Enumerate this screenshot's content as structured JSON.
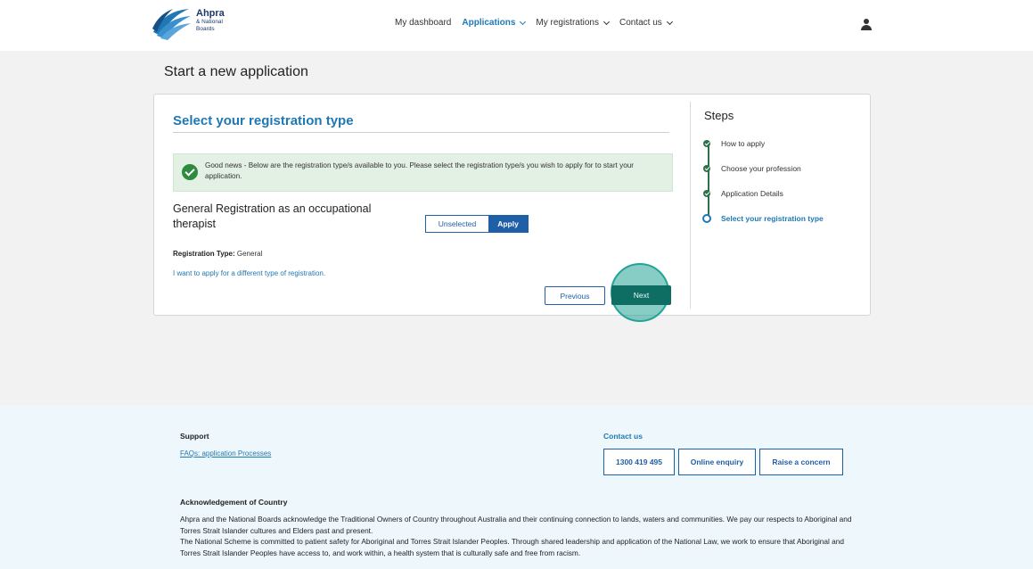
{
  "header": {
    "logo": {
      "title": "Ahpra",
      "line2": "& National",
      "line3": "Boards"
    },
    "nav": [
      {
        "label": "My dashboard",
        "dropdown": false,
        "active": false
      },
      {
        "label": "Applications",
        "dropdown": true,
        "active": true
      },
      {
        "label": "My registrations",
        "dropdown": true,
        "active": false
      },
      {
        "label": "Contact us",
        "dropdown": true,
        "active": false
      }
    ],
    "user_icon": "user-icon"
  },
  "page_title": "Start a new application",
  "form": {
    "section_title": "Select your registration type",
    "alert": {
      "icon": "check-circle-icon",
      "text": "Good news - Below are the registration type/s available to you. Please select the registration type/s you wish to apply for to start your application."
    },
    "registration": {
      "title": "General Registration as an occupational therapist",
      "toggle_unselected": "Unselected",
      "toggle_apply": "Apply",
      "selected": "Apply",
      "type_label": "Registration Type:",
      "type_value": "General",
      "different_link": "I want to apply for a different type of registration."
    },
    "buttons": {
      "previous": "Previous",
      "next": "Next"
    }
  },
  "steps": {
    "title": "Steps",
    "items": [
      {
        "label": "How to apply",
        "status": "complete"
      },
      {
        "label": "Choose your profession",
        "status": "complete"
      },
      {
        "label": "Application Details",
        "status": "complete"
      },
      {
        "label": "Select your registration type",
        "status": "current"
      }
    ]
  },
  "footer": {
    "support_heading": "Support",
    "support_link": "FAQs: application Processes",
    "contact_heading": "Contact us",
    "contact_buttons": [
      "1300 419 495",
      "Online enquiry",
      "Raise a concern"
    ],
    "ack_heading": "Acknowledgement of Country",
    "ack_p1": "Ahpra and the National Boards acknowledge the Traditional Owners of Country throughout Australia and their continuing connection to lands, waters and communities. We pay our respects to Aboriginal and Torres Strait Islander cultures and Elders past and present.",
    "ack_p2": "The National Scheme is committed to patient safety for Aboriginal and Torres Strait Islander Peoples. Through shared leadership and application of the National Law, we work to ensure that Aboriginal and Torres Strait Islander Peoples have access to, and work within, a health system that is culturally safe and free from racism."
  },
  "colors": {
    "accent_blue": "#1f78b4",
    "button_blue": "#1f5fa8",
    "success_green": "#2e8a3e",
    "next_teal": "#0e6e63",
    "footer_bg": "#eef8fc"
  }
}
